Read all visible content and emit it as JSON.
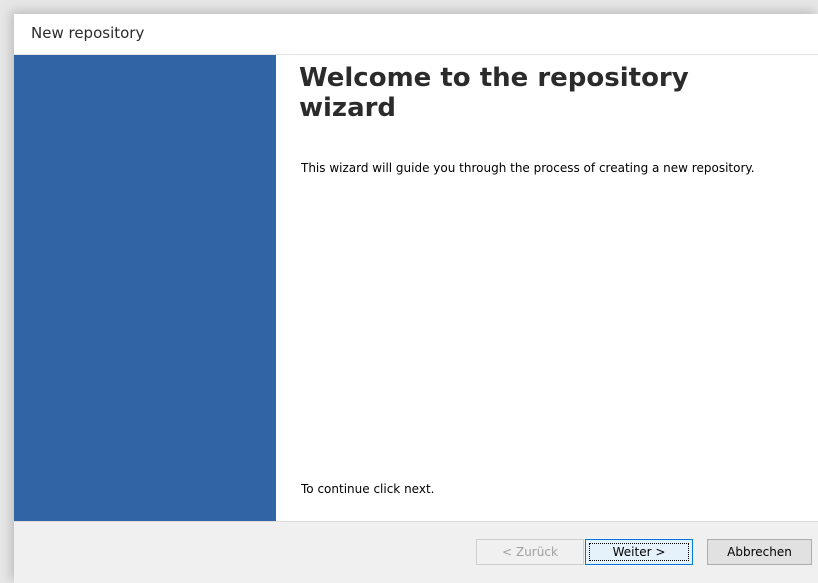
{
  "window": {
    "title": "New repository"
  },
  "wizard": {
    "heading": "Welcome to the repository wizard",
    "description": "This wizard will guide you through the process of creating a new repository.",
    "continue_hint": "To continue click next."
  },
  "buttons": {
    "back_label": "< Zurück",
    "next_label": "Weiter >",
    "cancel_label": "Abbrechen"
  },
  "colors": {
    "side_panel": "#2f65a4",
    "content_bg": "#ffffff",
    "footer_bg": "#f0f0f0"
  }
}
